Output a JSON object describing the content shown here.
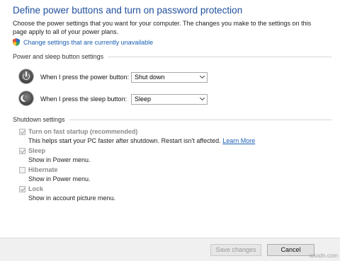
{
  "header": {
    "title": "Define power buttons and turn on password protection",
    "description_line1": "Choose the power settings that you want for your computer. The changes you make to the settings on this",
    "description_line2": "page apply to all of your power plans.",
    "change_link": "Change settings that are currently unavailable",
    "change_link_icon": "uac-shield-icon"
  },
  "power_sleep": {
    "section_title": "Power and sleep button settings",
    "power_label": "When I press the power button:",
    "power_value": "Shut down",
    "sleep_label": "When I press the sleep button:",
    "sleep_value": "Sleep"
  },
  "shutdown": {
    "section_title": "Shutdown settings",
    "options": [
      {
        "label": "Turn on fast startup (recommended)",
        "description": "This helps start your PC faster after shutdown. Restart isn't affected.",
        "link": "Learn More",
        "checked": true
      },
      {
        "label": "Sleep",
        "description": "Show in Power menu.",
        "checked": true
      },
      {
        "label": "Hibernate",
        "description": "Show in Power menu.",
        "checked": false
      },
      {
        "label": "Lock",
        "description": "Show in account picture menu.",
        "checked": true
      }
    ]
  },
  "footer": {
    "save_label": "Save changes",
    "cancel_label": "Cancel"
  },
  "watermark": "wsxdn.com",
  "colors": {
    "title": "#1f4e9c",
    "link": "#1a5fb4",
    "disabled_text": "#8a8a8a"
  }
}
